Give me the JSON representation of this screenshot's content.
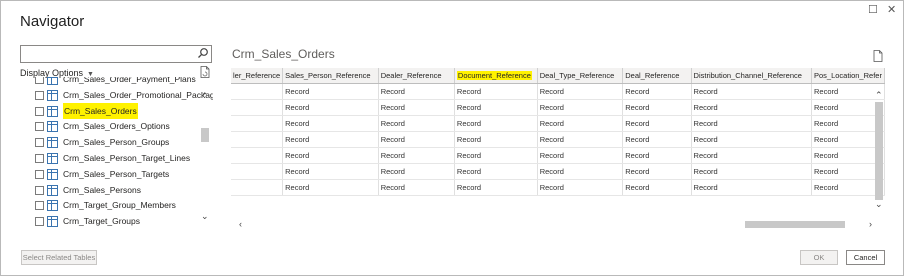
{
  "window": {
    "title": "Navigator",
    "restore_glyph": "☐",
    "close_glyph": "✕"
  },
  "left_pane": {
    "search": {
      "placeholder": "",
      "value": ""
    },
    "display_options_label": "Display Options",
    "tree_items": [
      {
        "label": "Crm_Sales_Order_Payment_Plans",
        "selected": false,
        "highlighted": false
      },
      {
        "label": "Crm_Sales_Order_Promotional_Packages",
        "selected": false,
        "highlighted": false
      },
      {
        "label": "Crm_Sales_Orders",
        "selected": true,
        "highlighted": true
      },
      {
        "label": "Crm_Sales_Orders_Options",
        "selected": false,
        "highlighted": false
      },
      {
        "label": "Crm_Sales_Person_Groups",
        "selected": false,
        "highlighted": false
      },
      {
        "label": "Crm_Sales_Person_Target_Lines",
        "selected": false,
        "highlighted": false
      },
      {
        "label": "Crm_Sales_Person_Targets",
        "selected": false,
        "highlighted": false
      },
      {
        "label": "Crm_Sales_Persons",
        "selected": false,
        "highlighted": false
      },
      {
        "label": "Crm_Target_Group_Members",
        "selected": false,
        "highlighted": false
      },
      {
        "label": "Crm_Target_Groups",
        "selected": false,
        "highlighted": false
      }
    ],
    "select_related_label": "Select Related Tables"
  },
  "preview": {
    "title": "Crm_Sales_Orders",
    "columns": [
      {
        "label": "ler_Reference",
        "highlighted": false
      },
      {
        "label": "Sales_Person_Reference",
        "highlighted": false
      },
      {
        "label": "Dealer_Reference",
        "highlighted": false
      },
      {
        "label": "Document_Reference",
        "highlighted": true
      },
      {
        "label": "Deal_Type_Reference",
        "highlighted": false
      },
      {
        "label": "Deal_Reference",
        "highlighted": false
      },
      {
        "label": "Distribution_Channel_Reference",
        "highlighted": false
      },
      {
        "label": "Pos_Location_Refer",
        "highlighted": false
      }
    ],
    "rows": [
      [
        "",
        "Record",
        "Record",
        "Record",
        "Record",
        "Record",
        "Record",
        "Record"
      ],
      [
        "",
        "Record",
        "Record",
        "Record",
        "Record",
        "Record",
        "Record",
        "Record"
      ],
      [
        "",
        "Record",
        "Record",
        "Record",
        "Record",
        "Record",
        "Record",
        "Record"
      ],
      [
        "",
        "Record",
        "Record",
        "Record",
        "Record",
        "Record",
        "Record",
        "Record"
      ],
      [
        "",
        "Record",
        "Record",
        "Record",
        "Record",
        "Record",
        "Record",
        "Record"
      ],
      [
        "",
        "Record",
        "Record",
        "Record",
        "Record",
        "Record",
        "Record",
        "Record"
      ],
      [
        "",
        "Record",
        "Record",
        "Record",
        "Record",
        "Record",
        "Record",
        "Record"
      ]
    ]
  },
  "footer": {
    "ok_label": "OK",
    "cancel_label": "Cancel"
  },
  "colors": {
    "highlight": "#fff200",
    "table_icon": "#3a74b0"
  }
}
